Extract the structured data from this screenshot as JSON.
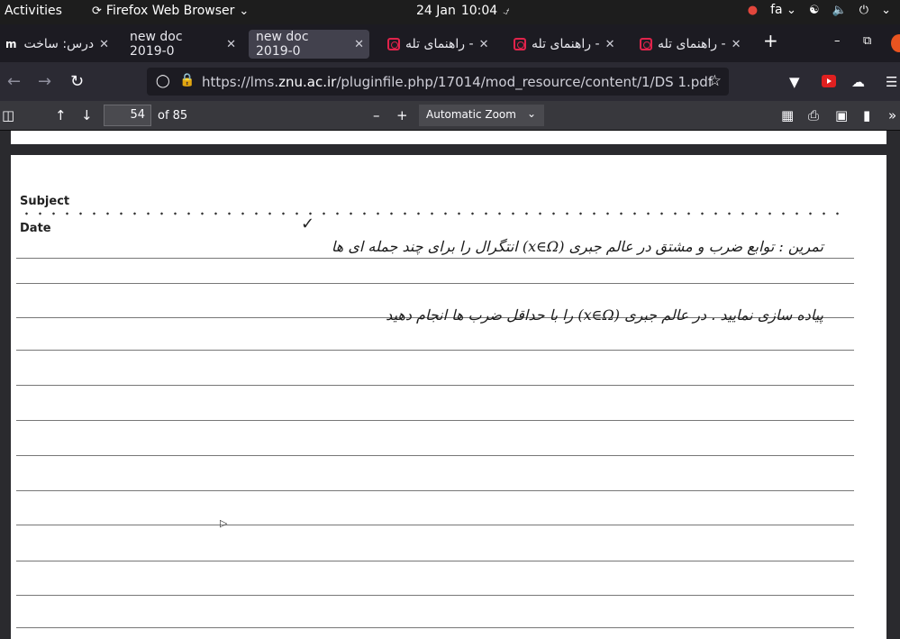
{
  "topbar": {
    "activities": "Activities",
    "app_name": "Firefox Web Browser",
    "date": "24 Jan",
    "time": "10:04",
    "keyboard_layout": "fa"
  },
  "tabs": [
    {
      "title": "درس: ساخت",
      "icon": "moodle-icon"
    },
    {
      "title": "new doc 2019-0",
      "icon": "none"
    },
    {
      "title": "new doc 2019-0",
      "icon": "none",
      "active": true
    },
    {
      "title": "راهنمای تله -",
      "icon": "app-icon"
    },
    {
      "title": "راهنمای تله -",
      "icon": "app-icon"
    },
    {
      "title": "راهنمای تله -",
      "icon": "app-icon"
    }
  ],
  "navbar": {
    "url_prefix": "https://lms.",
    "url_domain": "znu.ac.ir",
    "url_path": "/pluginfile.php/17014/mod_resource/content/1/DS 1.pdf"
  },
  "pdf_toolbar": {
    "page_number": "54",
    "page_count_label": "of 85",
    "zoom": "Automatic Zoom"
  },
  "page": {
    "subject_label": "Subject",
    "date_label": "Date",
    "handwritten_line_1": "تمرین : توابع ضرب و مشتق در عالم جبری (x∈Ω) انتگرال را برای چند جمله ای ها",
    "handwritten_line_2": "پیاده سازی نمایید . در عالم جبری (x∈Ω) را با حداقل ضرب ها انجام دهید"
  },
  "colors": {
    "topbar_bg": "#1d1d1d",
    "tabstrip_bg": "#1c1b22",
    "active_tab_bg": "#42414d",
    "toolbar_bg": "#2b2a33",
    "pdf_toolbar_bg": "#38383d",
    "window_close": "#e95420"
  }
}
